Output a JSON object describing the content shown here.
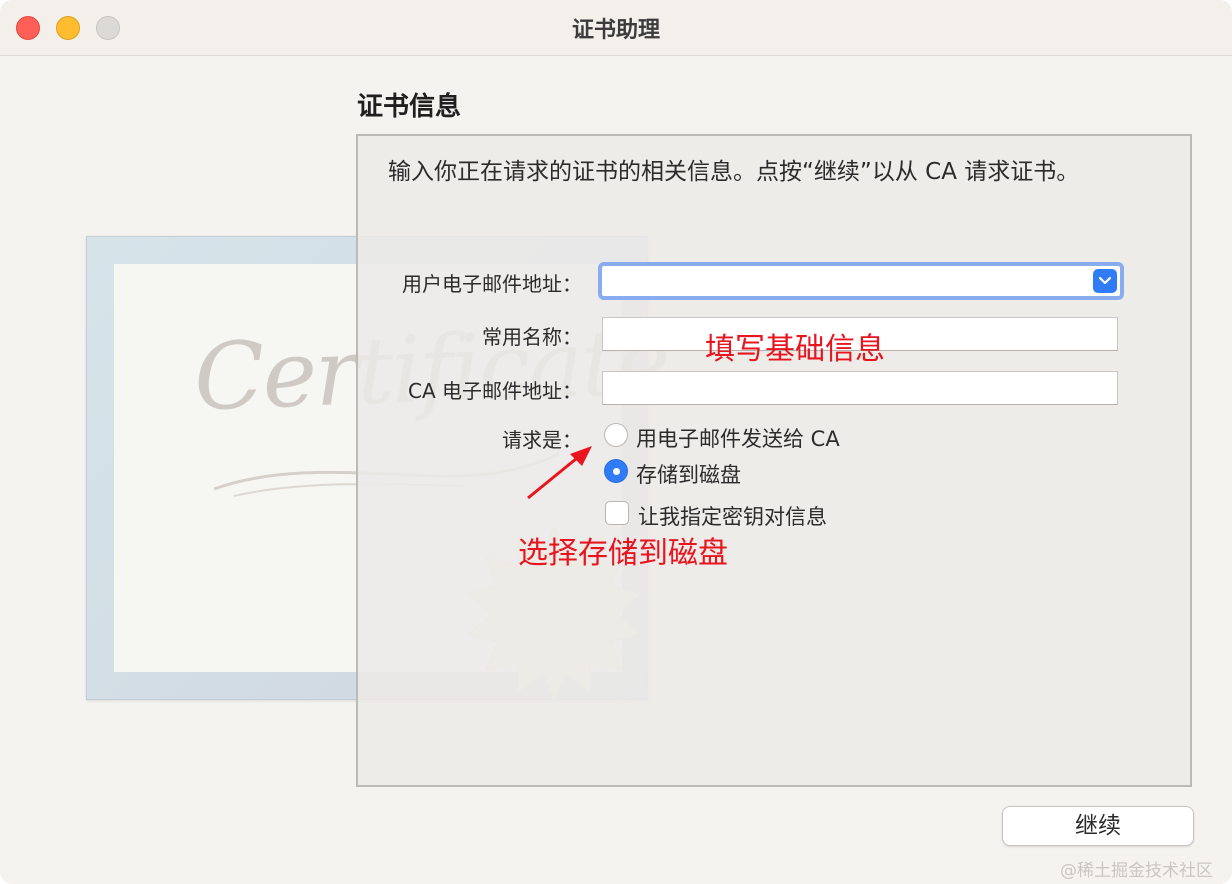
{
  "window": {
    "title": "证书助理"
  },
  "section": {
    "title": "证书信息"
  },
  "description": "输入你正在请求的证书的相关信息。点按“继续”以从 CA 请求证书。",
  "illustration": {
    "script_text": "Certificate"
  },
  "form": {
    "email_label": "用户电子邮件地址：",
    "email_value": "",
    "common_name_label": "常用名称：",
    "common_name_value": "",
    "ca_email_label": "CA 电子邮件地址：",
    "ca_email_value": "",
    "request_label": "请求是：",
    "options": [
      {
        "label": "用电子邮件发送给 CA",
        "selected": false
      },
      {
        "label": "存储到磁盘",
        "selected": true
      }
    ],
    "key_pair_checkbox": {
      "label": "让我指定密钥对信息",
      "checked": false
    }
  },
  "annotations": {
    "fill_info": "填写基础信息",
    "choose_disk": "选择存储到磁盘",
    "color": "#e8151f"
  },
  "buttons": {
    "continue": "继续"
  },
  "watermark": "@稀土掘金技术社区",
  "colors": {
    "accent": "#2f7cf6",
    "focus_ring": "#88acef"
  },
  "icons": {
    "close": "close-icon",
    "minimize": "minimize-icon",
    "zoom": "zoom-icon",
    "combo": "chevron-down-icon",
    "radio_checked": "radio-checked-icon",
    "annotation_arrow": "arrow-icon"
  }
}
